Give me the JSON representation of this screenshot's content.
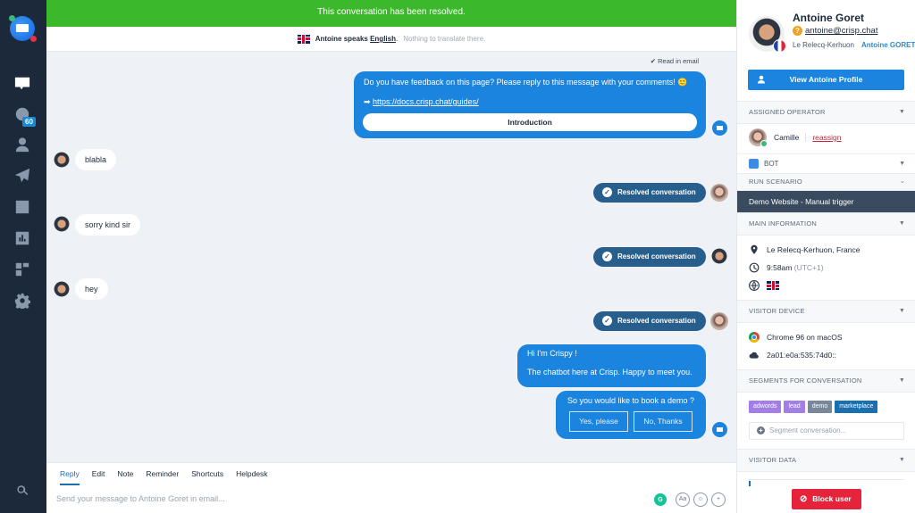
{
  "nav": {
    "items": [
      {
        "name": "conversations",
        "icon": "chat-icon"
      },
      {
        "name": "visitors",
        "icon": "globe-icon",
        "badge": "60"
      },
      {
        "name": "contacts",
        "icon": "user-icon"
      },
      {
        "name": "campaigns",
        "icon": "paper-plane-icon"
      },
      {
        "name": "helpdesk",
        "icon": "book-icon"
      },
      {
        "name": "analytics",
        "icon": "chart-icon"
      },
      {
        "name": "plugins",
        "icon": "grid-icon"
      },
      {
        "name": "settings",
        "icon": "gear-icon"
      }
    ],
    "search_icon": "search-icon"
  },
  "banner": {
    "text": "This conversation has been resolved.",
    "color": "#3bb92a"
  },
  "translation": {
    "prefix": "Antoine speaks ",
    "language": "English",
    "suffix": ".",
    "note": "Nothing to translate there."
  },
  "messages": {
    "read_status": "✔ Read in email",
    "feedback": {
      "text": "Do you have feedback on this page? Please reply to this message with your comments! 🙂",
      "link": "https://docs.crisp.chat/guides/",
      "button": "Introduction"
    },
    "visitor": [
      {
        "text": "blabla"
      },
      {
        "text": "sorry kind sir"
      },
      {
        "text": "hey"
      }
    ],
    "resolved_label": "Resolved conversation",
    "bot_greeting_line1": "Hi I'm Crispy !",
    "bot_greeting_line2": "The chatbot here at Crisp. Happy to meet you.",
    "demo_question": "So you would like to book a demo ?",
    "demo_choices": [
      "Yes, please",
      "No, Thanks"
    ]
  },
  "composer": {
    "tabs": [
      "Reply",
      "Edit",
      "Note",
      "Reminder",
      "Shortcuts",
      "Helpdesk"
    ],
    "active_tab": "Reply",
    "placeholder": "Send your message to Antoine Goret in email...",
    "tools": [
      "G",
      "Aa",
      "☺",
      "+"
    ]
  },
  "profile": {
    "name": "Antoine Goret",
    "email": "antoine@crisp.chat",
    "location": "Le Relecq-Kerhuon",
    "nickname": "Antoine GORET",
    "view_button": "View Antoine Profile"
  },
  "sections": {
    "assigned_operator": {
      "title": "ASSIGNED OPERATOR",
      "operator": "Camille",
      "action": "reassign"
    },
    "bot": {
      "label": "BOT"
    },
    "run_scenario": {
      "title": "RUN SCENARIO",
      "value": "Demo Website - Manual trigger"
    },
    "main_information": {
      "title": "MAIN INFORMATION",
      "location": "Le Relecq-Kerhuon, France",
      "time": "9:58am",
      "timezone": "(UTC+1)"
    },
    "visitor_device": {
      "title": "VISITOR DEVICE",
      "browser": "Chrome 96 on macOS",
      "ip": "2a01:e0a:535:74d0::"
    },
    "segments": {
      "title": "SEGMENTS FOR CONVERSATION",
      "tags": [
        {
          "label": "adwords",
          "color": "#a27ee6"
        },
        {
          "label": "lead",
          "color": "#a27ee6"
        },
        {
          "label": "demo",
          "color": "#7a8699"
        },
        {
          "label": "marketplace",
          "color": "#1a6fb0"
        }
      ],
      "placeholder": "Segment conversation..."
    },
    "visitor_data": {
      "title": "VISITOR DATA"
    }
  },
  "block_button": "Block user"
}
